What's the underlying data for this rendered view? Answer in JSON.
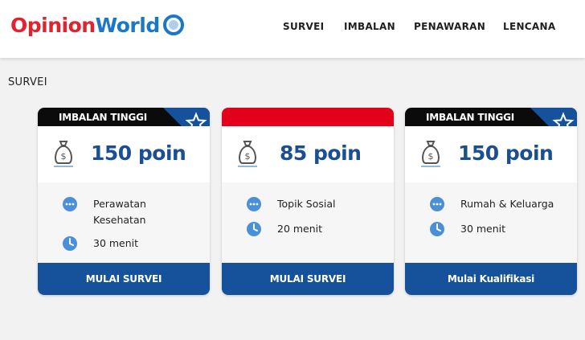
{
  "header": {
    "logo_part1": "Opinion",
    "logo_part2": "World",
    "nav": [
      "SURVEI",
      "IMBALAN",
      "PENAWARAN",
      "LENCANA"
    ]
  },
  "section_title": "SURVEI",
  "colors": {
    "brand_red": "#e0232f",
    "brand_blue": "#1a78c7",
    "button_blue": "#15529b",
    "points_blue": "#1b4f91",
    "banner_black": "#0b0b0b",
    "banner_red": "#e3001b"
  },
  "cards": [
    {
      "banner": "IMBALAN TINGGI",
      "banner_style": "black",
      "has_star_ribbon": true,
      "points": "150 poin",
      "topic": "Perawatan Kesehatan",
      "duration": "30 menit",
      "cta": "MULAI SURVEI",
      "icons": [
        "money-bag-icon",
        "chat-bubble-icon",
        "clock-icon",
        "star-icon"
      ]
    },
    {
      "banner": "",
      "banner_style": "red",
      "has_star_ribbon": false,
      "points": "85 poin",
      "topic": "Topik Sosial",
      "duration": "20 menit",
      "cta": "MULAI SURVEI",
      "icons": [
        "money-bag-icon",
        "chat-bubble-icon",
        "clock-icon"
      ]
    },
    {
      "banner": "IMBALAN TINGGI",
      "banner_style": "black",
      "has_star_ribbon": true,
      "points": "150 poin",
      "topic": "Rumah & Keluarga",
      "duration": "30 menit",
      "cta": "Mulai Kualifikasi",
      "icons": [
        "money-bag-icon",
        "chat-bubble-icon",
        "clock-icon",
        "star-icon"
      ]
    }
  ]
}
